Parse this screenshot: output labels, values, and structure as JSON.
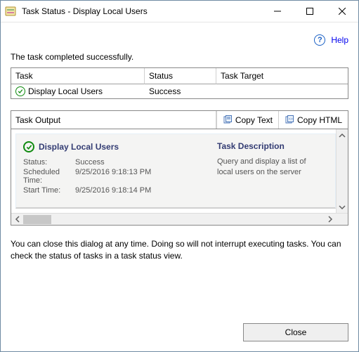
{
  "window": {
    "title": "Task Status - Display Local Users"
  },
  "help": {
    "label": "Help"
  },
  "status_message": "The task completed successfully.",
  "task_grid": {
    "headers": {
      "task": "Task",
      "status": "Status",
      "target": "Task Target"
    },
    "row": {
      "task": "Display Local Users",
      "status": "Success",
      "target": ""
    }
  },
  "output": {
    "label": "Task Output",
    "copy_text": "Copy Text",
    "copy_html": "Copy HTML",
    "task_title": "Display Local Users",
    "desc_header": "Task Description",
    "desc": "Query and display a list of local users on the server",
    "kv": {
      "status_k": "Status:",
      "status_v": "Success",
      "sched_k": "Scheduled Time:",
      "sched_v": "9/25/2016 9:18:13 PM",
      "start_k": "Start Time:",
      "start_v": "9/25/2016 9:18:14 PM"
    }
  },
  "notice": "You can close this dialog at any time. Doing so will not interrupt executing tasks. You can check the status of tasks in a task status view.",
  "buttons": {
    "close": "Close"
  }
}
